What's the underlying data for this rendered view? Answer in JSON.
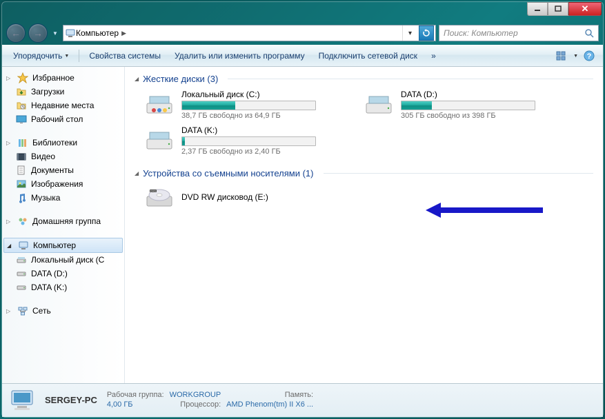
{
  "breadcrumb": {
    "root": "Компьютер"
  },
  "search": {
    "placeholder": "Поиск: Компьютер"
  },
  "toolbar": {
    "organize": "Упорядочить",
    "properties": "Свойства системы",
    "uninstall": "Удалить или изменить программу",
    "map_drive": "Подключить сетевой диск"
  },
  "sidebar": {
    "favorites": "Избранное",
    "fav_items": [
      "Загрузки",
      "Недавние места",
      "Рабочий стол"
    ],
    "libraries": "Библиотеки",
    "lib_items": [
      "Видео",
      "Документы",
      "Изображения",
      "Музыка"
    ],
    "homegroup": "Домашняя группа",
    "computer": "Компьютер",
    "comp_items": [
      "Локальный диск (C",
      "DATA (D:)",
      "DATA (K:)"
    ],
    "network": "Сеть"
  },
  "sections": {
    "drives_title": "Жесткие диски (3)",
    "removable_title": "Устройства со съемными носителями (1)"
  },
  "drives": [
    {
      "name": "Локальный диск (C:)",
      "stat": "38,7 ГБ свободно из 64,9 ГБ",
      "used_pct": 40
    },
    {
      "name": "DATA (D:)",
      "stat": "305 ГБ свободно из 398 ГБ",
      "used_pct": 23
    },
    {
      "name": "DATA (K:)",
      "stat": "2,37 ГБ свободно из 2,40 ГБ",
      "used_pct": 2
    }
  ],
  "removable": [
    {
      "name": "DVD RW дисковод (E:)"
    }
  ],
  "status": {
    "name": "SERGEY-PC",
    "workgroup_label": "Рабочая группа:",
    "workgroup": "WORKGROUP",
    "memory_label": "Память:",
    "memory": "4,00 ГБ",
    "cpu_label": "Процессор:",
    "cpu": "AMD Phenom(tm) II X6 ..."
  }
}
